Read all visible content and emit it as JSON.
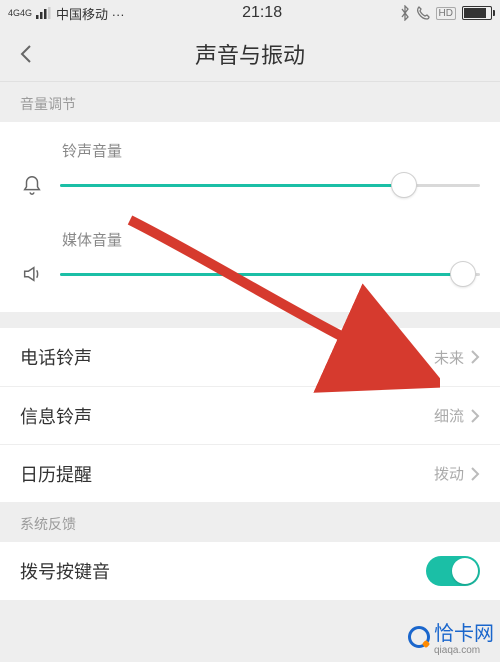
{
  "status": {
    "signal_label": "4G4G",
    "carrier": "中国移动 ···",
    "time": "21:18",
    "hd_label": "HD"
  },
  "nav": {
    "title": "声音与振动"
  },
  "sections": {
    "volume_header": "音量调节",
    "feedback_header": "系统反馈"
  },
  "sliders": {
    "ringtone": {
      "label": "铃声音量",
      "percent": 82
    },
    "media": {
      "label": "媒体音量",
      "percent": 96
    }
  },
  "items": {
    "phone_ringtone": {
      "label": "电话铃声",
      "value": "未来"
    },
    "message_ringtone": {
      "label": "信息铃声",
      "value": "细流"
    },
    "calendar_reminder": {
      "label": "日历提醒",
      "value": "拨动"
    },
    "dial_pad": {
      "label": "拨号按键音",
      "on": true
    }
  },
  "watermark": {
    "name": "恰卡网",
    "domain": "qiaqa.com"
  },
  "colors": {
    "accent": "#1bbfa6"
  }
}
